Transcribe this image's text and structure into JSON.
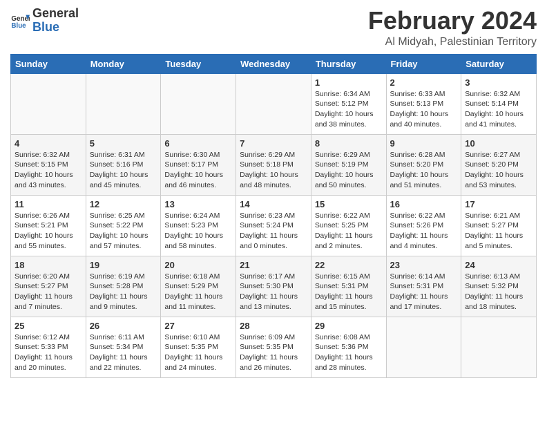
{
  "header": {
    "logo_general": "General",
    "logo_blue": "Blue",
    "month_year": "February 2024",
    "location": "Al Midyah, Palestinian Territory"
  },
  "weekdays": [
    "Sunday",
    "Monday",
    "Tuesday",
    "Wednesday",
    "Thursday",
    "Friday",
    "Saturday"
  ],
  "weeks": [
    [
      {
        "day": "",
        "info": ""
      },
      {
        "day": "",
        "info": ""
      },
      {
        "day": "",
        "info": ""
      },
      {
        "day": "",
        "info": ""
      },
      {
        "day": "1",
        "info": "Sunrise: 6:34 AM\nSunset: 5:12 PM\nDaylight: 10 hours\nand 38 minutes."
      },
      {
        "day": "2",
        "info": "Sunrise: 6:33 AM\nSunset: 5:13 PM\nDaylight: 10 hours\nand 40 minutes."
      },
      {
        "day": "3",
        "info": "Sunrise: 6:32 AM\nSunset: 5:14 PM\nDaylight: 10 hours\nand 41 minutes."
      }
    ],
    [
      {
        "day": "4",
        "info": "Sunrise: 6:32 AM\nSunset: 5:15 PM\nDaylight: 10 hours\nand 43 minutes."
      },
      {
        "day": "5",
        "info": "Sunrise: 6:31 AM\nSunset: 5:16 PM\nDaylight: 10 hours\nand 45 minutes."
      },
      {
        "day": "6",
        "info": "Sunrise: 6:30 AM\nSunset: 5:17 PM\nDaylight: 10 hours\nand 46 minutes."
      },
      {
        "day": "7",
        "info": "Sunrise: 6:29 AM\nSunset: 5:18 PM\nDaylight: 10 hours\nand 48 minutes."
      },
      {
        "day": "8",
        "info": "Sunrise: 6:29 AM\nSunset: 5:19 PM\nDaylight: 10 hours\nand 50 minutes."
      },
      {
        "day": "9",
        "info": "Sunrise: 6:28 AM\nSunset: 5:20 PM\nDaylight: 10 hours\nand 51 minutes."
      },
      {
        "day": "10",
        "info": "Sunrise: 6:27 AM\nSunset: 5:20 PM\nDaylight: 10 hours\nand 53 minutes."
      }
    ],
    [
      {
        "day": "11",
        "info": "Sunrise: 6:26 AM\nSunset: 5:21 PM\nDaylight: 10 hours\nand 55 minutes."
      },
      {
        "day": "12",
        "info": "Sunrise: 6:25 AM\nSunset: 5:22 PM\nDaylight: 10 hours\nand 57 minutes."
      },
      {
        "day": "13",
        "info": "Sunrise: 6:24 AM\nSunset: 5:23 PM\nDaylight: 10 hours\nand 58 minutes."
      },
      {
        "day": "14",
        "info": "Sunrise: 6:23 AM\nSunset: 5:24 PM\nDaylight: 11 hours\nand 0 minutes."
      },
      {
        "day": "15",
        "info": "Sunrise: 6:22 AM\nSunset: 5:25 PM\nDaylight: 11 hours\nand 2 minutes."
      },
      {
        "day": "16",
        "info": "Sunrise: 6:22 AM\nSunset: 5:26 PM\nDaylight: 11 hours\nand 4 minutes."
      },
      {
        "day": "17",
        "info": "Sunrise: 6:21 AM\nSunset: 5:27 PM\nDaylight: 11 hours\nand 5 minutes."
      }
    ],
    [
      {
        "day": "18",
        "info": "Sunrise: 6:20 AM\nSunset: 5:27 PM\nDaylight: 11 hours\nand 7 minutes."
      },
      {
        "day": "19",
        "info": "Sunrise: 6:19 AM\nSunset: 5:28 PM\nDaylight: 11 hours\nand 9 minutes."
      },
      {
        "day": "20",
        "info": "Sunrise: 6:18 AM\nSunset: 5:29 PM\nDaylight: 11 hours\nand 11 minutes."
      },
      {
        "day": "21",
        "info": "Sunrise: 6:17 AM\nSunset: 5:30 PM\nDaylight: 11 hours\nand 13 minutes."
      },
      {
        "day": "22",
        "info": "Sunrise: 6:15 AM\nSunset: 5:31 PM\nDaylight: 11 hours\nand 15 minutes."
      },
      {
        "day": "23",
        "info": "Sunrise: 6:14 AM\nSunset: 5:31 PM\nDaylight: 11 hours\nand 17 minutes."
      },
      {
        "day": "24",
        "info": "Sunrise: 6:13 AM\nSunset: 5:32 PM\nDaylight: 11 hours\nand 18 minutes."
      }
    ],
    [
      {
        "day": "25",
        "info": "Sunrise: 6:12 AM\nSunset: 5:33 PM\nDaylight: 11 hours\nand 20 minutes."
      },
      {
        "day": "26",
        "info": "Sunrise: 6:11 AM\nSunset: 5:34 PM\nDaylight: 11 hours\nand 22 minutes."
      },
      {
        "day": "27",
        "info": "Sunrise: 6:10 AM\nSunset: 5:35 PM\nDaylight: 11 hours\nand 24 minutes."
      },
      {
        "day": "28",
        "info": "Sunrise: 6:09 AM\nSunset: 5:35 PM\nDaylight: 11 hours\nand 26 minutes."
      },
      {
        "day": "29",
        "info": "Sunrise: 6:08 AM\nSunset: 5:36 PM\nDaylight: 11 hours\nand 28 minutes."
      },
      {
        "day": "",
        "info": ""
      },
      {
        "day": "",
        "info": ""
      }
    ]
  ]
}
